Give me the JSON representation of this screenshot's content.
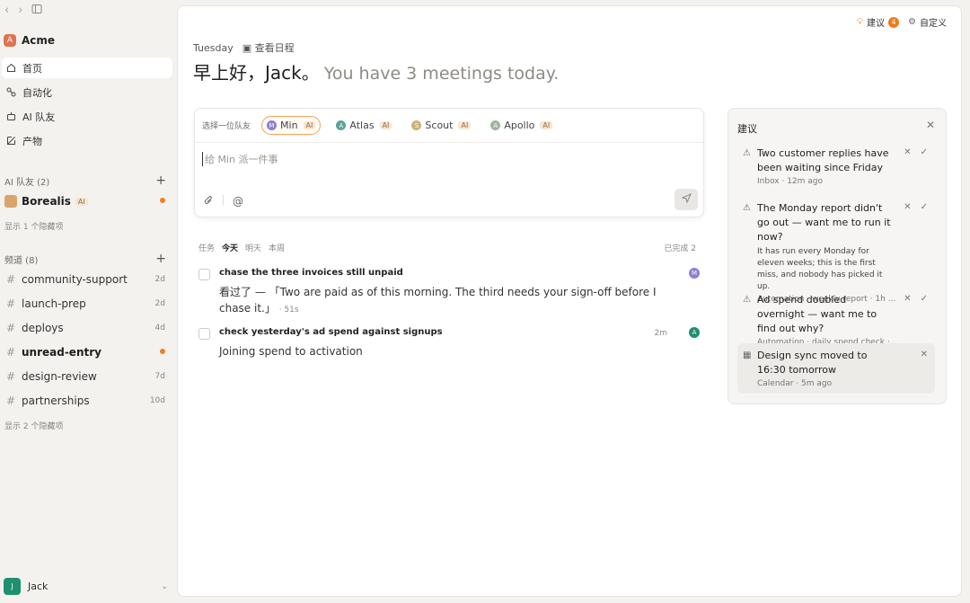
{
  "sidebar": {
    "workspace": {
      "initial": "A",
      "name": "Acme"
    },
    "nav": [
      {
        "label": "首页",
        "icon": "home-icon"
      },
      {
        "label": "自动化",
        "icon": "automation-icon"
      },
      {
        "label": "AI 队友",
        "icon": "robot-icon"
      },
      {
        "label": "产物",
        "icon": "artifact-icon"
      }
    ],
    "ai_section": {
      "title": "AI 队友 (2)",
      "member": "Borealis",
      "member_tag": "AI",
      "hidden_link": "显示 1 个隐藏项"
    },
    "channels_section": {
      "title": "频道 (8)",
      "channels": [
        {
          "name": "community-support",
          "meta": "2d"
        },
        {
          "name": "launch-prep",
          "meta": "2d"
        },
        {
          "name": "deploys",
          "meta": "4d"
        },
        {
          "name": "unread-entry",
          "meta": ""
        },
        {
          "name": "design-review",
          "meta": "7d"
        },
        {
          "name": "partnerships",
          "meta": "10d"
        }
      ],
      "hidden_link": "显示 2 个隐藏项"
    },
    "user": {
      "initial": "J",
      "name": "Jack"
    }
  },
  "main": {
    "suggestions_button": "建议",
    "suggestions_count": "4",
    "customize_button": "自定义",
    "day": "Tuesday",
    "view_schedule": "查看日程",
    "greeting": "早上好，Jack。",
    "greeting_sub": "You have 3 meetings today.",
    "composer": {
      "picker_label": "选择一位队友",
      "mates": [
        {
          "name": "Min",
          "initial": "M",
          "tag": "AI",
          "color": "#8d7fd0"
        },
        {
          "name": "Atlas",
          "initial": "A",
          "tag": "AI",
          "color": "#5aa39a"
        },
        {
          "name": "Scout",
          "initial": "S",
          "tag": "AI",
          "color": "#c9b27a"
        },
        {
          "name": "Apollo",
          "initial": "A",
          "tag": "AI",
          "color": "#9fb59c"
        }
      ],
      "placeholder": "给 Min 派一件事"
    },
    "tasks": {
      "label": "任务",
      "tabs": [
        "今天",
        "明天",
        "本周"
      ],
      "done": "已完成 2",
      "items": [
        {
          "title": "chase the three invoices still unpaid",
          "body": "看过了 — 「Two are paid as of this morning. The third needs your sign-off before I chase it.」",
          "age": "· 51s",
          "time": "",
          "avatar": "M",
          "avatar_color": "#8d7fd0"
        },
        {
          "title": "check yesterday's ad spend against signups",
          "body": "Joining spend to activation",
          "age": "",
          "time": "2m",
          "avatar": "A",
          "avatar_color": "#1f8f6f"
        }
      ]
    }
  },
  "suggestions": {
    "title": "建议",
    "items": [
      {
        "title": "Two customer replies have been waiting since Friday",
        "desc": "",
        "meta": "Inbox · 12m ago",
        "icon": "warning-icon"
      },
      {
        "title": "The Monday report didn't go out — want me to run it now?",
        "desc": "It has run every Monday for eleven weeks; this is the first miss, and nobody has picked it up.",
        "meta": "Automation · weekly report · 1h ...",
        "icon": "warning-icon"
      },
      {
        "title": "Ad spend doubled overnight — want me to find out why?",
        "desc": "",
        "meta": "Automation · daily spend check · ...",
        "icon": "warning-icon"
      },
      {
        "title": "Design sync moved to 16:30 tomorrow",
        "desc": "",
        "meta": "Calendar · 5m ago",
        "icon": "calendar-icon"
      }
    ]
  }
}
